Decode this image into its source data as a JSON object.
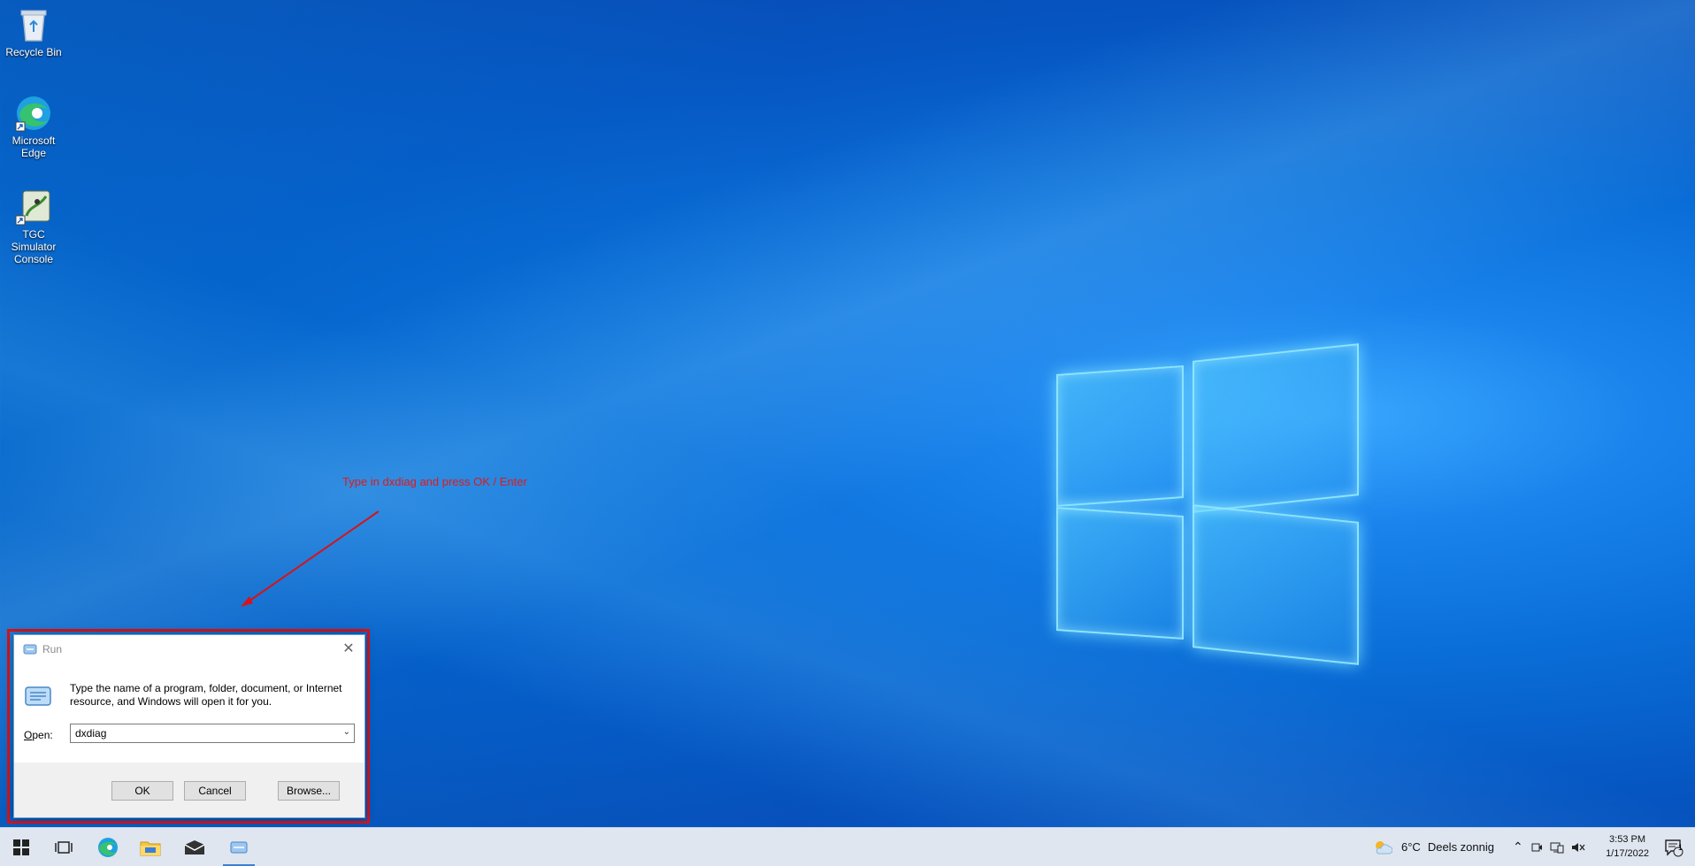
{
  "desktop_icons": [
    {
      "label": "Recycle Bin",
      "icon": "recycle-bin-icon"
    },
    {
      "label": "Microsoft Edge",
      "icon": "edge-icon"
    },
    {
      "label": "TGC Simulator Console",
      "icon": "tgc-simulator-icon"
    }
  ],
  "annotation": {
    "text": "Type in dxdiag and press OK / Enter",
    "color": "#e01a1a"
  },
  "run_dialog": {
    "title": "Run",
    "description": "Type the name of a program, folder, document, or Internet resource, and Windows will open it for you.",
    "open_label_prefix": "O",
    "open_label_rest": "pen:",
    "open_value": "dxdiag",
    "buttons": {
      "ok": "OK",
      "cancel": "Cancel",
      "browse": "Browse..."
    }
  },
  "taskbar": {
    "weather": {
      "temp": "6°C",
      "condition": "Deels zonnig"
    },
    "time": "3:53 PM",
    "date": "1/17/2022",
    "notification_count": "1"
  },
  "colors": {
    "accent": "#3a7fd6",
    "highlight_box": "#d6141a"
  }
}
